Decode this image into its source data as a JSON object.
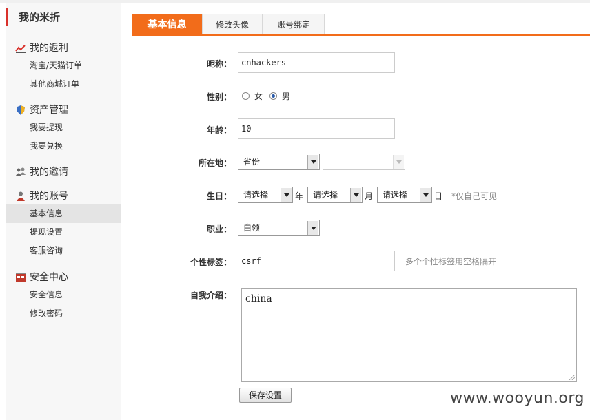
{
  "sidebar": {
    "title": "我的米折",
    "groups": [
      {
        "label": "我的返利",
        "icon": "trend-chart-icon",
        "items": [
          "淘宝/天猫订单",
          "其他商城订单"
        ]
      },
      {
        "label": "资产管理",
        "icon": "shield-icon",
        "items": [
          "我要提现",
          "我要兑换"
        ]
      },
      {
        "label": "我的邀请",
        "icon": "users-icon",
        "items": []
      },
      {
        "label": "我的账号",
        "icon": "user-icon",
        "items": [
          "基本信息",
          "提现设置",
          "客服咨询"
        ],
        "active_item": "基本信息"
      },
      {
        "label": "安全中心",
        "icon": "security-center-icon",
        "items": [
          "安全信息",
          "修改密码"
        ]
      }
    ]
  },
  "tabs": [
    "基本信息",
    "修改头像",
    "账号绑定"
  ],
  "active_tab": "基本信息",
  "form": {
    "nickname": {
      "label": "昵称：",
      "value": "cnhackers"
    },
    "gender": {
      "label": "性别：",
      "options": [
        "女",
        "男"
      ],
      "selected": "男"
    },
    "age": {
      "label": "年龄：",
      "value": "10"
    },
    "location": {
      "label": "所在地：",
      "province": "省份",
      "city": ""
    },
    "birthday": {
      "label": "生日：",
      "year": "请选择",
      "year_unit": "年",
      "month": "请选择",
      "month_unit": "月",
      "day": "请选择",
      "day_unit": "日",
      "hint": "*仅自己可见"
    },
    "occupation": {
      "label": "职业：",
      "value": "白领"
    },
    "tags": {
      "label": "个性标签：",
      "value": "csrf",
      "hint": "多个个性标签用空格隔开"
    },
    "intro": {
      "label": "自我介绍：",
      "value": "china"
    },
    "save_label": "保存设置"
  },
  "watermark": "www.wooyun.org",
  "colors": {
    "accent": "#f26c1a",
    "sidebar_marker": "#d9312b"
  }
}
